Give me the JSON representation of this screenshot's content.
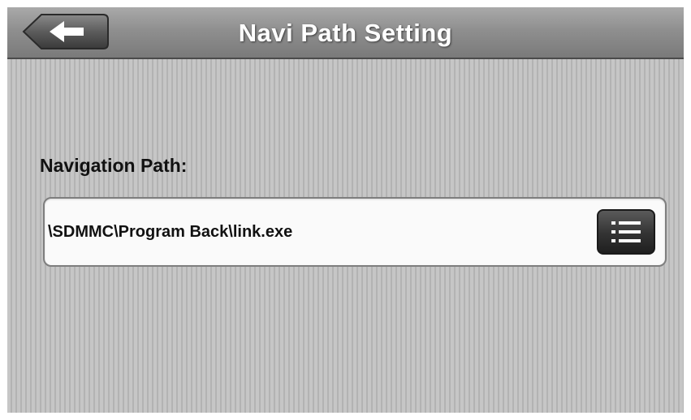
{
  "header": {
    "title": "Navi Path Setting",
    "back_icon": "back-arrow-icon"
  },
  "main": {
    "section_label": "Navigation Path:",
    "path_value": "\\SDMMC\\Program Back\\link.exe",
    "browse_icon": "list-icon"
  },
  "colors": {
    "titlebar": "#8f8f8f",
    "background": "#c2c2c2",
    "field_background": "#fafafa",
    "button_dark": "#333333",
    "title_text": "#ffffff"
  }
}
